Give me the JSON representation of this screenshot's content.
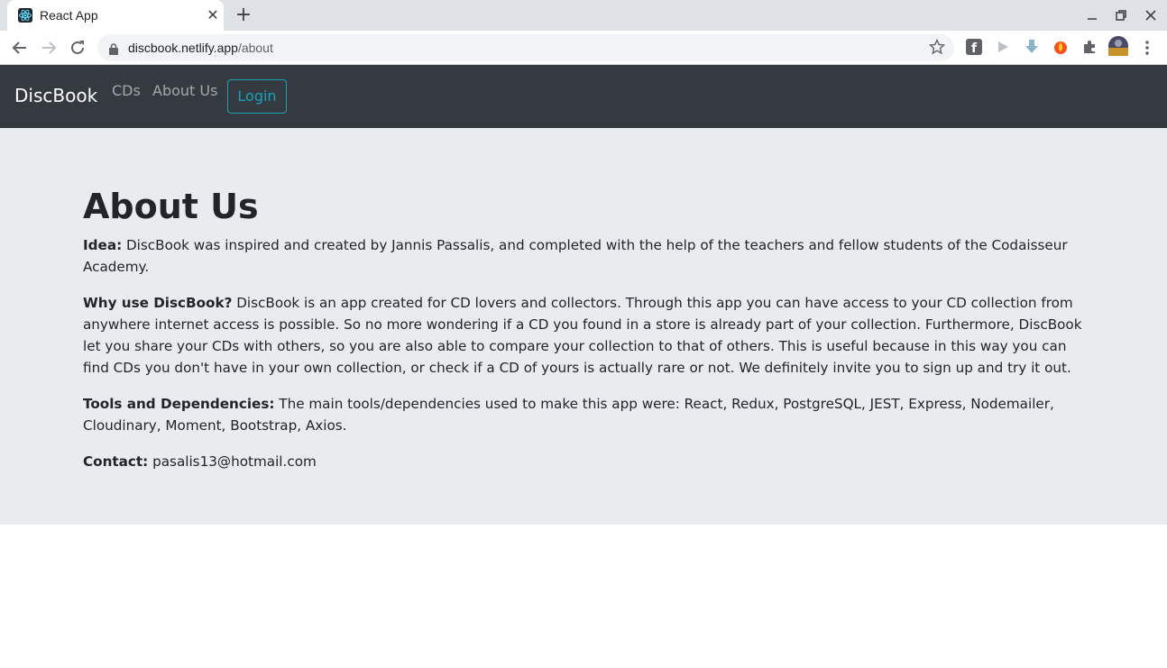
{
  "browser": {
    "tab_title": "React App",
    "tab_close": "✕",
    "new_tab": "+",
    "url_host": "discbook.netlify.app",
    "url_path": "/about",
    "icons": [
      "back-arrow-icon",
      "forward-arrow-icon",
      "reload-icon",
      "lock-icon",
      "bookmark-star-icon",
      "extensions-icon",
      "menu-icon"
    ]
  },
  "navbar": {
    "brand": "DiscBook",
    "links": [
      "CDs",
      "About Us"
    ],
    "login_label": "Login",
    "colors": {
      "background": "#343a40",
      "accent": "#17a2b8"
    }
  },
  "about": {
    "title": "About Us",
    "idea_label": "Idea:",
    "idea_text": " DiscBook was inspired and created by Jannis Passalis, and completed with the help of the teachers and fellow students of the Codaisseur Academy.",
    "why_label": "Why use DiscBook?",
    "why_text": " DiscBook is an app created for CD lovers and collectors. Through this app you can have access to your CD collection from anywhere internet access is possible. So no more wondering if a CD you found in a store is already part of your collection. Furthermore, DiscBook let you share your CDs with others, so you are also able to compare your collection to that of others. This is useful because in this way you can find CDs you don't have in your own collection, or check if a CD of yours is actually rare or not. We definitely invite you to sign up and try it out.",
    "tools_label": "Tools and Dependencies:",
    "tools_text": " The main tools/dependencies used to make this app were: React, Redux, PostgreSQL, JEST, Express, Nodemailer, Cloudinary, Moment, Bootstrap, Axios.",
    "contact_label": "Contact:",
    "contact_text": " pasalis13@hotmail.com"
  }
}
